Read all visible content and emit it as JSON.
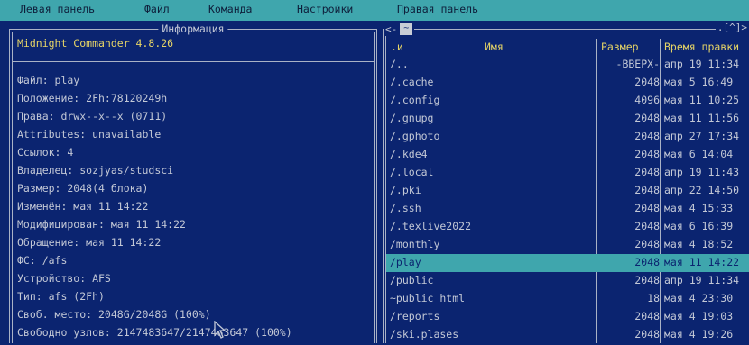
{
  "menubar": {
    "items": [
      {
        "label": "Левая панель"
      },
      {
        "label": "Файл"
      },
      {
        "label": "Команда"
      },
      {
        "label": "Настройки"
      },
      {
        "label": "Правая панель"
      }
    ]
  },
  "left_panel": {
    "title": "Информация",
    "version": "Midnight Commander 4.8.26",
    "lines": [
      "Файл: play",
      " Положение: 2Fh:78120249h",
      " Права: drwx--x--x (0711)",
      " Attributes: unavailable",
      " Ссылок: 4",
      " Владелец: sozjyas/studsci",
      " Размер: 2048(4 блока)",
      " Изменён: мая 11 14:22",
      " Модифицирован: мая 11 14:22",
      " Обращение: мая 11 14:22",
      " ФС: /afs",
      " Устройство: AFS",
      " Тип: afs (2Fh)",
      " Своб. место: 2048G/2048G (100%)",
      " Свободно узлов: 2147483647/2147483647 (100%)"
    ]
  },
  "right_panel": {
    "nav_left": "<-",
    "nav_tilde": "~",
    "nav_right": ".[^]>",
    "headers": {
      "sort": ".и",
      "name": "Имя",
      "size": "Размер",
      "mtime": "Время правки"
    },
    "files": [
      {
        "name": "/..",
        "size": "-ВВЕРХ-",
        "mtime": "апр 19 11:34",
        "selected": false
      },
      {
        "name": "/.cache",
        "size": "2048",
        "mtime": "мая  5 16:49",
        "selected": false
      },
      {
        "name": "/.config",
        "size": "4096",
        "mtime": "мая 11 10:25",
        "selected": false
      },
      {
        "name": "/.gnupg",
        "size": "2048",
        "mtime": "мая 11 11:56",
        "selected": false
      },
      {
        "name": "/.gphoto",
        "size": "2048",
        "mtime": "апр 27 17:34",
        "selected": false
      },
      {
        "name": "/.kde4",
        "size": "2048",
        "mtime": "мая  6 14:04",
        "selected": false
      },
      {
        "name": "/.local",
        "size": "2048",
        "mtime": "апр 19 11:43",
        "selected": false
      },
      {
        "name": "/.pki",
        "size": "2048",
        "mtime": "апр 22 14:50",
        "selected": false
      },
      {
        "name": "/.ssh",
        "size": "2048",
        "mtime": "мая  4 15:33",
        "selected": false
      },
      {
        "name": "/.texlive2022",
        "size": "2048",
        "mtime": "мая  6 16:39",
        "selected": false
      },
      {
        "name": "/monthly",
        "size": "2048",
        "mtime": "мая  4 18:52",
        "selected": false
      },
      {
        "name": "/play",
        "size": "2048",
        "mtime": "мая 11 14:22",
        "selected": true
      },
      {
        "name": "/public",
        "size": "2048",
        "mtime": "апр 19 11:34",
        "selected": false
      },
      {
        "name": "~public_html",
        "size": "18",
        "mtime": "мая  4 23:30",
        "selected": false
      },
      {
        "name": "/reports",
        "size": "2048",
        "mtime": "мая  4 19:03",
        "selected": false
      },
      {
        "name": "/ski.plases",
        "size": "2048",
        "mtime": "мая  4 19:26",
        "selected": false
      }
    ]
  },
  "colors": {
    "background": "#0b2470",
    "menubar": "#3fa6ad",
    "highlight": "#3fa6ad",
    "header_text": "#e6d466",
    "text": "#c3c8d6"
  },
  "icons": {
    "cursor": "mouse-pointer-icon"
  }
}
